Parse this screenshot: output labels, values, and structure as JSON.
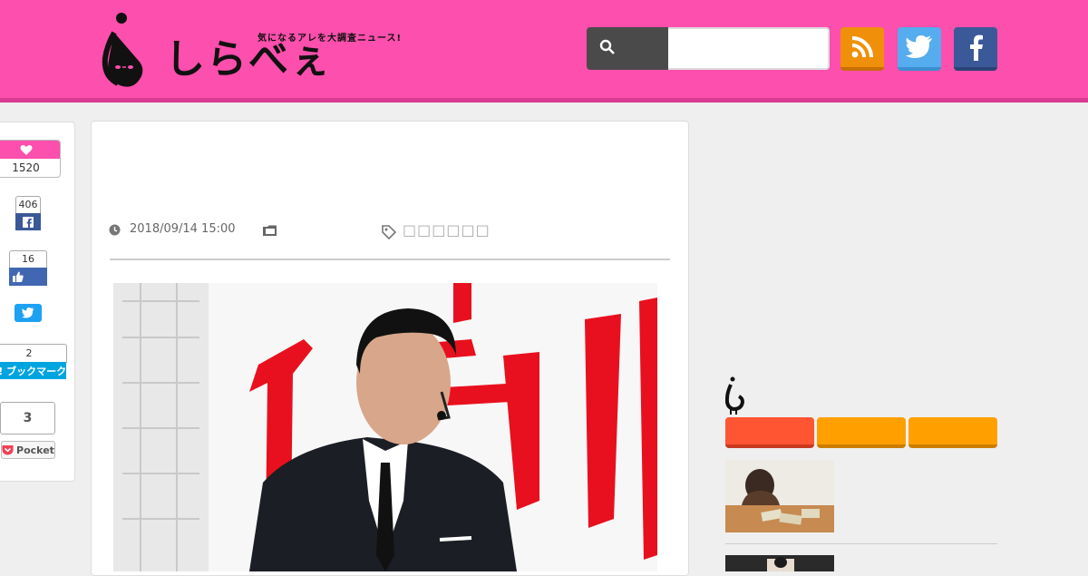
{
  "header": {
    "tagline": "気になるアレを大調査ニュース!",
    "logo_text": "しらべぇ",
    "search_placeholder": "",
    "icons": {
      "search": "search-icon",
      "rss": "rss-icon",
      "twitter": "twitter-icon",
      "facebook": "facebook-icon"
    },
    "colors": {
      "brand": "#fd4fad",
      "rss": "#f0900a",
      "twitter": "#55acee",
      "facebook": "#3b5998"
    }
  },
  "share": {
    "like_count": "1520",
    "facebook_count": "406",
    "facebook_like_count": "16",
    "hatena_count": "2",
    "hatena_label": "B! ブックマーク",
    "pocket_count": "3",
    "pocket_label": "Pocket"
  },
  "article": {
    "date": "2018/09/14 15:00",
    "tags": "□□□□□□"
  },
  "sidebar": {
    "tabs": [
      {
        "color": "#ff5533"
      },
      {
        "color": "#ffa000"
      },
      {
        "color": "#ffa000"
      }
    ]
  }
}
